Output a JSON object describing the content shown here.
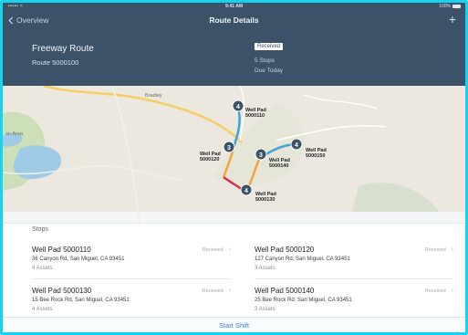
{
  "status_bar": {
    "signal": "•••••  ≈",
    "time": "9:41 AM",
    "battery": "100%"
  },
  "nav": {
    "back_label": "Overview",
    "title": "Route Details",
    "add_icon": "plus-icon"
  },
  "route": {
    "name": "Freeway Route",
    "number": "Route 5000100",
    "status_badge": "Received",
    "stops_count": "5 Stops",
    "due": "Due Today"
  },
  "map": {
    "town_label": "Bradley",
    "area_label": "on Area",
    "pins": [
      {
        "count": "4",
        "line1": "Well Pad",
        "line2": "5000110"
      },
      {
        "count": "3",
        "line1": "Well Pad",
        "line2": "5000120"
      },
      {
        "count": "3",
        "line1": "Well Pad",
        "line2": "5000140"
      },
      {
        "count": "4",
        "line1": "Well Pad",
        "line2": "5000150"
      },
      {
        "count": "4",
        "line1": "Well Pad",
        "line2": "5000130"
      }
    ],
    "colors": {
      "route_blue": "#3fa3dc",
      "route_orange": "#f2a43a",
      "route_red": "#d9304a",
      "road_yellow": "#f5cf63",
      "water": "#9fcbe6",
      "park": "#bcd7a3"
    }
  },
  "stops": {
    "heading": "Stops",
    "items": [
      {
        "name": "Well Pad 5000110",
        "address": "36 Canyon Rd, San Miguel, CA 93451",
        "assets": "4 Assets",
        "status": "Received"
      },
      {
        "name": "Well Pad 5000120",
        "address": "127 Canyon Rd, San Miguel, CA 93451",
        "assets": "3 Assets",
        "status": "Received"
      },
      {
        "name": "Well Pad 5000130",
        "address": "15 Bee Rock Rd, San Miguel, CA 93451",
        "assets": "4 Assets",
        "status": "Received"
      },
      {
        "name": "Well Pad 5000140",
        "address": "25 Bee Rock Rd, San Miguel, CA 93451",
        "assets": "3 Assets",
        "status": "Received"
      }
    ]
  },
  "footer": {
    "start_label": "Start Shift"
  }
}
